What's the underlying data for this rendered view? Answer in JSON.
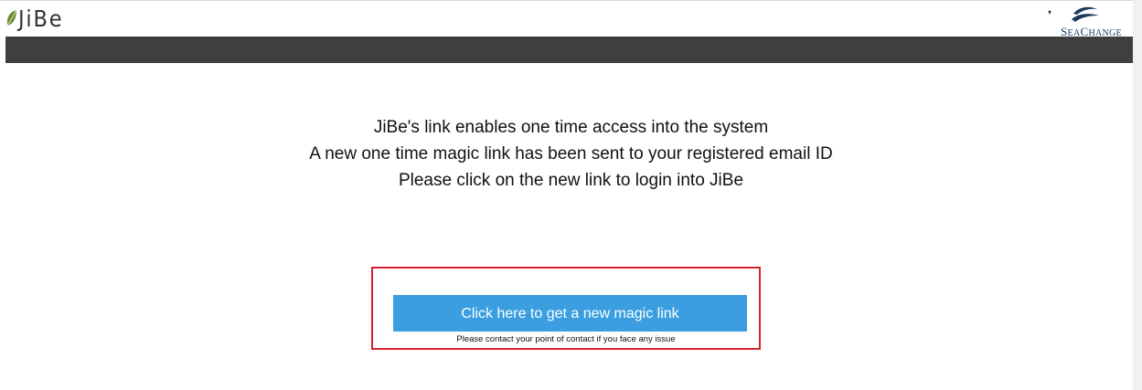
{
  "header": {
    "logo_text": "JiBe",
    "brand_logo": {
      "prefix": "S",
      "small": "EA",
      "c": "C",
      "rest": "HANGE"
    },
    "user_menu_caret": "▾"
  },
  "main": {
    "lines": [
      "JiBe's link enables one time access into the system",
      "A new one time magic link has been sent to your registered email ID",
      "Please click on the new link to login into JiBe"
    ],
    "button_label": "Click here to get a new magic link",
    "contact_note": "Please contact your point of contact if you face any issue"
  },
  "colors": {
    "navbar": "#3f3f3f",
    "button": "#3a9ee0",
    "highlight_border": "#d7202e",
    "logo_leaf": "#6c8a2e"
  }
}
